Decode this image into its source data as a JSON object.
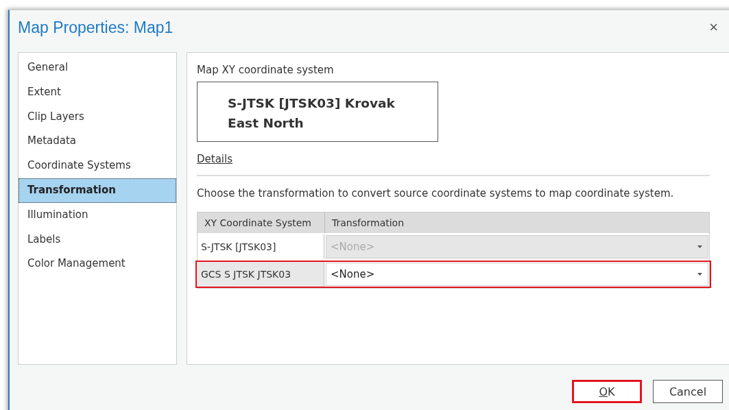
{
  "window": {
    "title": "Map Properties: Map1",
    "close": "×"
  },
  "sidebar": {
    "items": [
      {
        "label": "General",
        "selected": false
      },
      {
        "label": "Extent",
        "selected": false
      },
      {
        "label": "Clip Layers",
        "selected": false
      },
      {
        "label": "Metadata",
        "selected": false
      },
      {
        "label": "Coordinate Systems",
        "selected": false
      },
      {
        "label": "Transformation",
        "selected": true
      },
      {
        "label": "Illumination",
        "selected": false
      },
      {
        "label": "Labels",
        "selected": false
      },
      {
        "label": "Color Management",
        "selected": false
      }
    ]
  },
  "content": {
    "coordinate_system_label": "Map XY coordinate system",
    "coordinate_system": "S-JTSK [JTSK03] Krovak East North",
    "details_link": "Details",
    "instruction": "Choose the transformation to convert source coordinate systems to map coordinate system.",
    "table": {
      "columns": [
        "XY Coordinate System",
        "Transformation"
      ],
      "rows": [
        {
          "system": "S-JTSK [JTSK03]",
          "transformation": "<None>",
          "disabled": true,
          "highlighted": false
        },
        {
          "system": "GCS S JTSK JTSK03",
          "transformation": "<None>",
          "disabled": false,
          "highlighted": true
        }
      ]
    }
  },
  "buttons": [
    {
      "label": "OK",
      "underline_first": true,
      "highlighted": true
    },
    {
      "label": "Cancel",
      "underline_first": false,
      "highlighted": false
    }
  ]
}
